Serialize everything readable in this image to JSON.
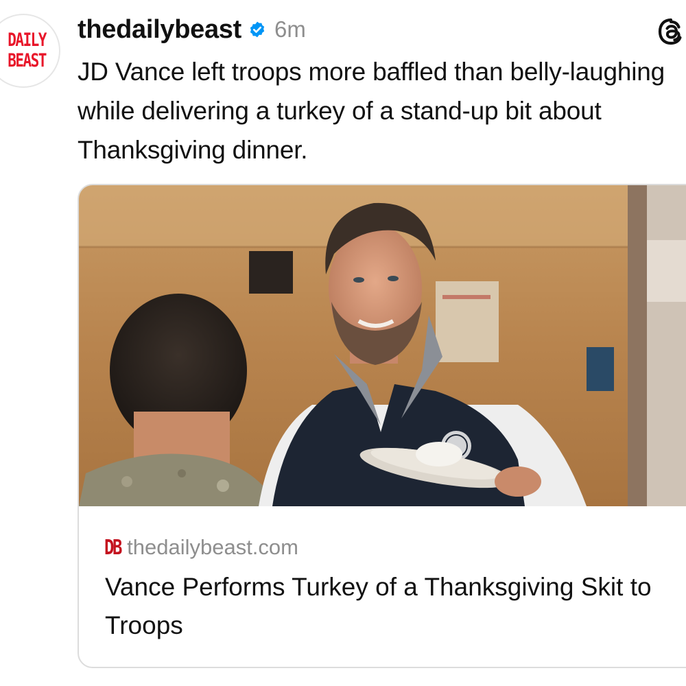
{
  "avatar": {
    "line1": "DAILY",
    "line2": "BEAST",
    "color": "#e8162a"
  },
  "post": {
    "username": "thedailybeast",
    "verified_icon": "verified-badge-icon",
    "time": "6m",
    "caption": "JD Vance left troops more baffled than belly-laughing while delivering a turkey of a stand-up bit about Thanksgiving dinner."
  },
  "app_icon": "threads-icon",
  "link_card": {
    "image_icon": "article-photo",
    "source_logo": "DB",
    "domain": "thedailybeast.com",
    "title": "Vance Performs Turkey of a Thanksgiving Skit to Troops"
  },
  "colors": {
    "verified_blue": "#0095f6",
    "muted_text": "#8e8e8e",
    "brand_red": "#c4121f"
  }
}
